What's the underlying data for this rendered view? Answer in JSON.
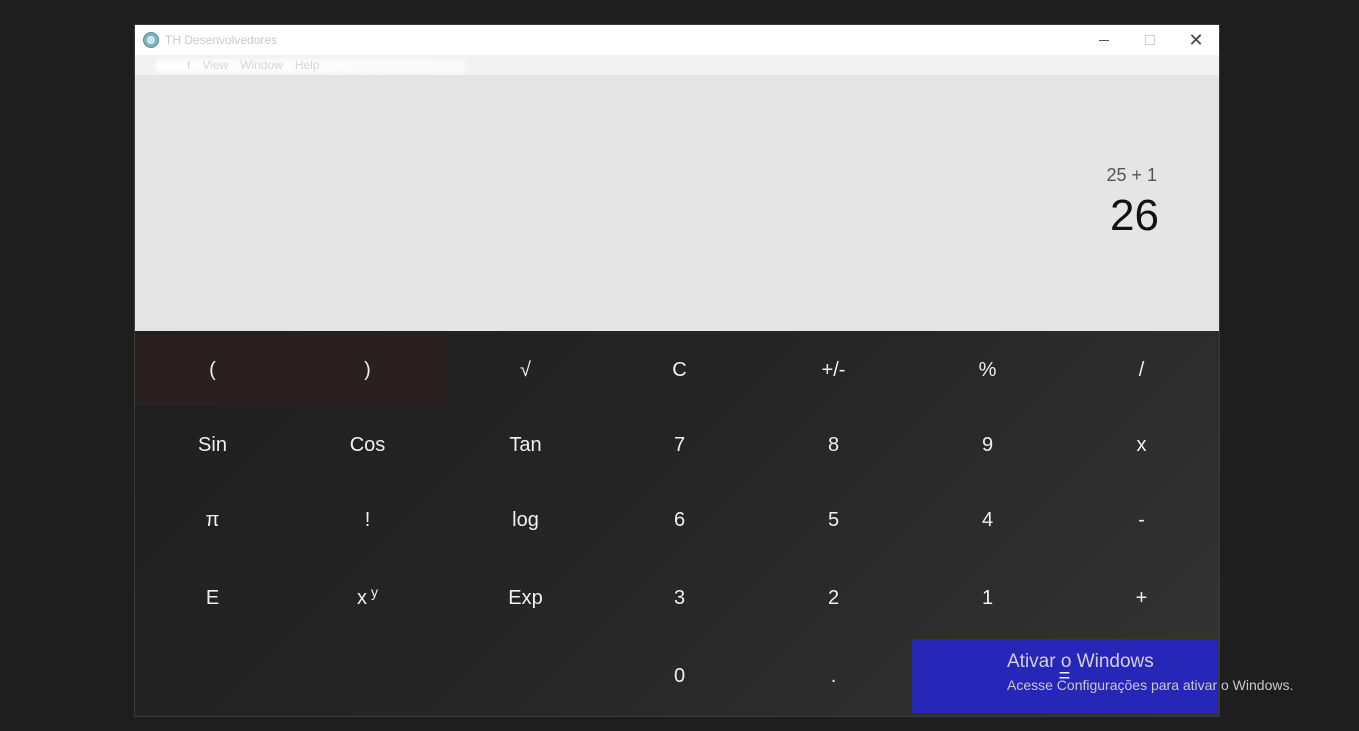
{
  "window": {
    "title": "TH Desenvolvedores",
    "minimize_label": "–",
    "maximize_label": "",
    "close_label": "✕"
  },
  "menu": {
    "items": [
      "t",
      "View",
      "Window",
      "Help"
    ]
  },
  "display": {
    "expression": "25 + 1",
    "result": "26"
  },
  "keys": {
    "open_paren": "(",
    "close_paren": ")",
    "sqrt": "√",
    "clear": "C",
    "negate": "+/-",
    "percent": "%",
    "divide": "/",
    "sin": "Sin",
    "cos": "Cos",
    "tan": "Tan",
    "seven": "7",
    "eight": "8",
    "nine": "9",
    "multiply": "x",
    "pi": "π",
    "factorial": "!",
    "log": "log",
    "six": "6",
    "five": "5",
    "four": "4",
    "minus": "-",
    "e": "E",
    "power_base": "x",
    "power_exp": "y",
    "exp": "Exp",
    "three": "3",
    "two": "2",
    "one": "1",
    "plus": "+",
    "zero": "0",
    "dot": ".",
    "equals": "="
  },
  "watermark": {
    "title": "Ativar o Windows",
    "subtitle": "Acesse Configurações para ativar o Windows."
  },
  "colors": {
    "display_bg": "#e5e5e5",
    "keypad_bg": "#262626",
    "equals_bg": "#2626b8",
    "paren_bg": "#2a2020"
  }
}
